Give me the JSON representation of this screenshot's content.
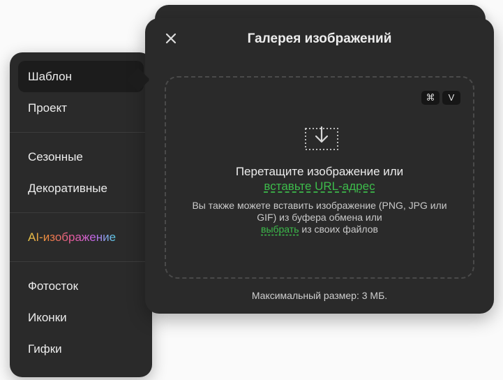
{
  "sidebar": {
    "group1": [
      "Шаблон",
      "Проект"
    ],
    "group2": [
      "Сезонные",
      "Декоративные"
    ],
    "ai_item": "AI-изображение",
    "group3": [
      "Фотосток",
      "Иконки",
      "Гифки"
    ],
    "active_item": "Шаблон"
  },
  "dialog": {
    "title": "Галерея изображений",
    "shortcut": {
      "modifier": "⌘",
      "key": "V"
    },
    "drop_text": "Перетащите изображение или",
    "paste_url_link": "вставьте URL-адрес",
    "sub_text_before": "Вы также можете вставить изображение (PNG, JPG или GIF) из буфера обмена или",
    "choose_link": "выбрать",
    "sub_text_after": "из своих файлов",
    "max_size": "Максимальный размер: 3 МБ."
  },
  "icons": {
    "close": "close-icon",
    "upload": "upload-tray-icon"
  },
  "colors": {
    "panel": "#2a2a2a",
    "active_item": "#1c1c1c",
    "link_green": "#3dbb4b",
    "background": "#fafafa"
  }
}
